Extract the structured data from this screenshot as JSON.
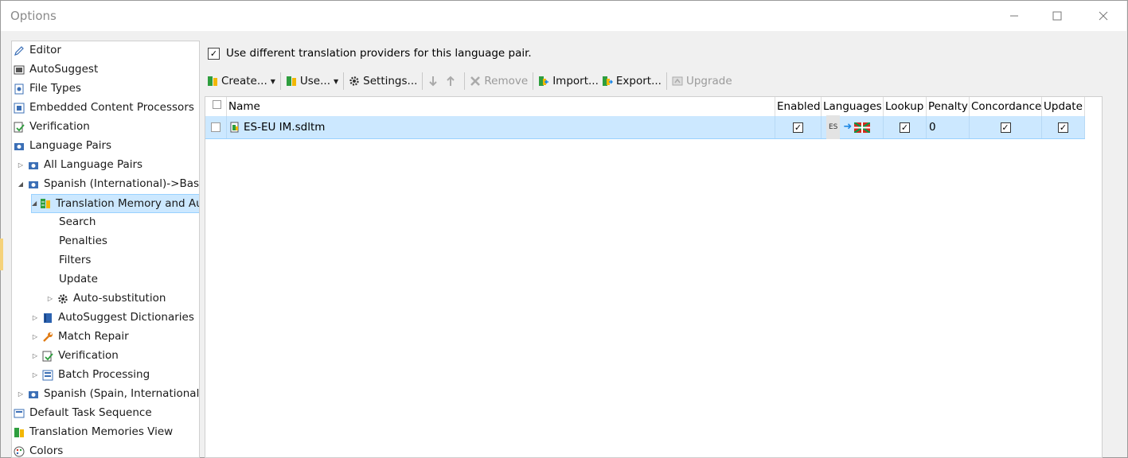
{
  "window": {
    "title": "Options"
  },
  "tree": [
    {
      "label": "Editor",
      "icon": "pencil-icon",
      "level": 0
    },
    {
      "label": "AutoSuggest",
      "icon": "autosuggest-icon",
      "level": 0
    },
    {
      "label": "File Types",
      "icon": "file-types-icon",
      "level": 0
    },
    {
      "label": "Embedded Content Processors",
      "icon": "embedded-content-icon",
      "level": 0
    },
    {
      "label": "Verification",
      "icon": "verification-icon",
      "level": 0
    },
    {
      "label": "Language Pairs",
      "icon": "language-pairs-icon",
      "level": 0
    },
    {
      "label": "All Language Pairs",
      "icon": "language-pairs-icon",
      "level": 1
    },
    {
      "label": "Spanish (International)->Basqu",
      "icon": "language-pairs-icon",
      "level": 1
    },
    {
      "label": "Translation Memory and Au",
      "icon": "translation-memory-icon",
      "level": 2
    },
    {
      "label": "Search",
      "icon": "",
      "level": 3
    },
    {
      "label": "Penalties",
      "icon": "",
      "level": 3
    },
    {
      "label": "Filters",
      "icon": "",
      "level": 3
    },
    {
      "label": "Update",
      "icon": "",
      "level": 3
    },
    {
      "label": "Auto-substitution",
      "icon": "gear-icon",
      "level": 3
    },
    {
      "label": "AutoSuggest Dictionaries",
      "icon": "dictionary-icon",
      "level": 2
    },
    {
      "label": "Match Repair",
      "icon": "wrench-icon",
      "level": 2
    },
    {
      "label": "Verification",
      "icon": "verification-icon",
      "level": 2
    },
    {
      "label": "Batch Processing",
      "icon": "batch-icon",
      "level": 2
    },
    {
      "label": "Spanish (Spain, International S",
      "icon": "language-pairs-icon",
      "level": 1
    },
    {
      "label": "Default Task Sequence",
      "icon": "task-sequence-icon",
      "level": 0
    },
    {
      "label": "Translation Memories View",
      "icon": "translation-memory-icon",
      "level": 0
    },
    {
      "label": "Colors",
      "icon": "palette-icon",
      "level": 0
    }
  ],
  "main": {
    "use_different_label": "Use different translation providers for this language pair.",
    "toolbar": {
      "create": "Create...",
      "use": "Use...",
      "settings": "Settings...",
      "remove": "Remove",
      "import": "Import...",
      "export": "Export...",
      "upgrade": "Upgrade"
    },
    "columns": [
      "Name",
      "Enabled",
      "Languages",
      "Lookup",
      "Penalty",
      "Concordance",
      "Update"
    ],
    "rows": [
      {
        "name": "ES-EU IM.sdltm",
        "enabled": true,
        "source_lang": "ES",
        "lookup": true,
        "penalty": "0",
        "concordance": true,
        "update": true
      }
    ]
  },
  "colors": {
    "selection": "#cce8ff",
    "selection_border": "#99d1ff"
  }
}
